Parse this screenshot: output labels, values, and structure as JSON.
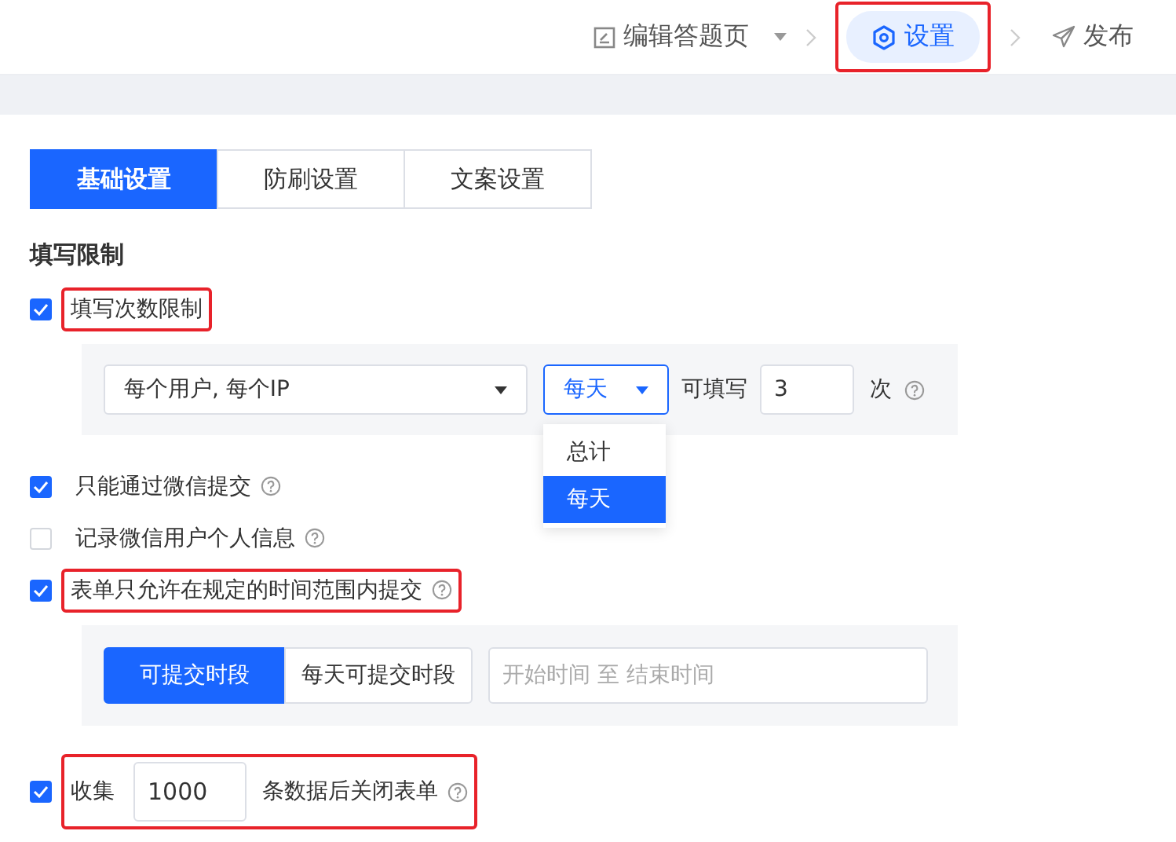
{
  "nav": [
    {
      "kind": "edit",
      "label": "编辑答题页",
      "selected": false,
      "highlighted": false
    },
    {
      "kind": "settings",
      "label": "设置",
      "selected": true,
      "highlighted": true
    },
    {
      "kind": "publish",
      "label": "发布",
      "selected": false,
      "highlighted": false
    }
  ],
  "tabs": [
    {
      "label": "基础设置",
      "selected": true
    },
    {
      "label": "防刷设置",
      "selected": false
    },
    {
      "label": "文案设置",
      "selected": false
    }
  ],
  "section_title": "填写限制",
  "options": [
    {
      "kind": "limit",
      "label": "填写次数限制",
      "checked": true,
      "highlighted": true,
      "help": false,
      "panel": {
        "scope": "每个用户, 每个IP",
        "period": "每天",
        "mid_label": "可填写",
        "count": "3",
        "unit": "次",
        "help": true,
        "dropdown": [
          {
            "label": "总计",
            "selected": false
          },
          {
            "label": "每天",
            "selected": true
          }
        ]
      }
    },
    {
      "kind": "plain",
      "label": "只能通过微信提交",
      "checked": true,
      "highlighted": false,
      "help": true
    },
    {
      "kind": "plain",
      "label": "记录微信用户个人信息",
      "checked": false,
      "highlighted": false,
      "help": true
    },
    {
      "kind": "time",
      "label": "表单只允许在规定的时间范围内提交",
      "checked": true,
      "highlighted": true,
      "help": true,
      "panel": {
        "modes": [
          {
            "label": "可提交时段",
            "selected": true
          },
          {
            "label": "每天可提交时段",
            "selected": false
          }
        ],
        "range_placeholder": "开始时间 至 结束时间"
      }
    },
    {
      "kind": "collect",
      "label": "收集",
      "value": "1000",
      "suffix": "条数据后关闭表单",
      "checked": true,
      "highlighted": true,
      "help": true
    }
  ]
}
